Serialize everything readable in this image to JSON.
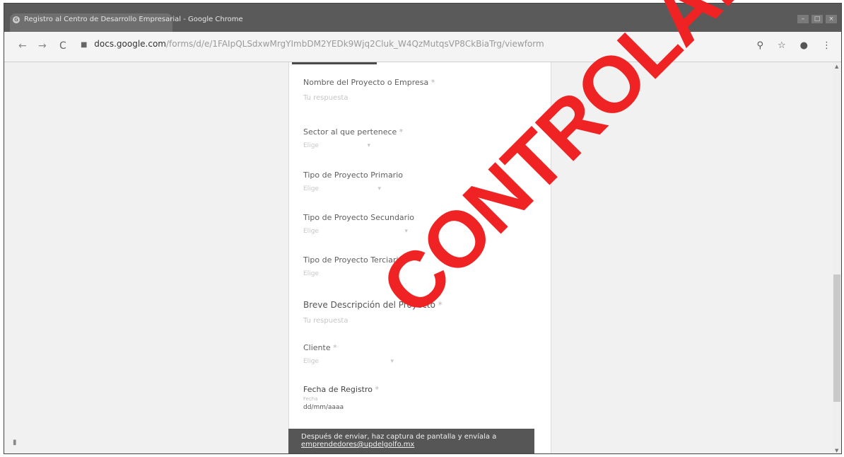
{
  "window": {
    "title": "Registro al Centro de Desarrollo Empresarial - Google Chrome",
    "controls": [
      "–",
      "□",
      "×"
    ]
  },
  "toolbar": {
    "url_domain": "docs.google.com",
    "url_path": "/forms/d/e/1FAIpQLSdxwMrgYImbDM2YEDk9Wjq2Cluk_W4QzMutqsVP8CkBiaTrg/viewform",
    "back": "←",
    "forward": "→",
    "reload": "C",
    "zoom_icon": "⚲",
    "star_icon": "☆",
    "menu_icon": "⋮",
    "profile_icon": "●"
  },
  "form": {
    "fields": [
      {
        "label": "Nombre del Proyecto o Empresa",
        "required": "*",
        "placeholder": "Tu respuesta"
      },
      {
        "label": "Sector al que pertenece",
        "required": "*",
        "select": "Elige",
        "chevron": "▾"
      },
      {
        "label": "Tipo de Proyecto Primario",
        "required": "",
        "select": "Elige",
        "chevron": "▾"
      },
      {
        "label": "Tipo de Proyecto Secundario",
        "required": "",
        "select": "Elige",
        "chevron": "▾"
      },
      {
        "label": "Tipo de Proyecto Terciario",
        "required": "",
        "select": "Elige",
        "chevron": "▾"
      },
      {
        "label": "Breve Descripción del Proyecto",
        "required": "*",
        "placeholder": "Tu respuesta"
      },
      {
        "label": "Cliente",
        "required": "*",
        "select": "Elige",
        "chevron": "▾"
      },
      {
        "label": "Fecha de Registro",
        "required": "*",
        "hint": "Fecha",
        "value": "dd/mm/aaaa"
      }
    ]
  },
  "banner": {
    "text": "Después de enviar, haz captura de pantalla y envíala a",
    "email": "emprendedores@updelgolfo.mx"
  },
  "watermark": {
    "text": "CONTROLADO",
    "color": "#ef2323"
  }
}
